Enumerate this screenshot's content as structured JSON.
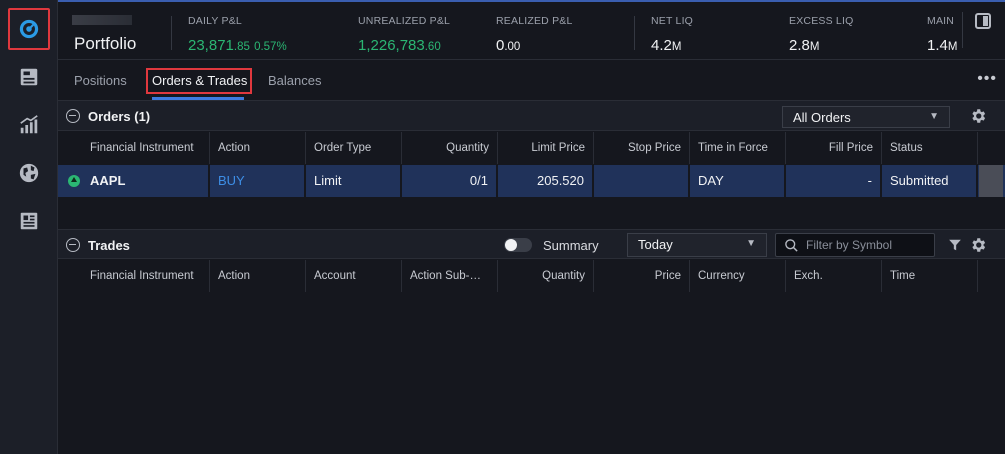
{
  "header": {
    "title": "Portfolio",
    "metrics": [
      {
        "label": "DAILY P&L",
        "value": "23,871",
        "decimals": ".85",
        "extra": "0.57%"
      },
      {
        "label": "UNREALIZED P&L",
        "value": "1,226,783",
        "decimals": ".60",
        "extra": ""
      },
      {
        "label": "REALIZED P&L",
        "value": "0",
        "decimals": ".00",
        "extra": ""
      },
      {
        "label": "NET LIQ",
        "value": "4.2",
        "decimals": "M",
        "extra": ""
      },
      {
        "label": "EXCESS LIQ",
        "value": "2.8",
        "decimals": "M",
        "extra": ""
      },
      {
        "label": "MAIN",
        "value": "1.4",
        "decimals": "M",
        "extra": ""
      }
    ]
  },
  "tabs": [
    "Positions",
    "Orders & Trades",
    "Balances"
  ],
  "more": "•••",
  "orders": {
    "title": "Orders (1)",
    "filter": "All Orders",
    "columns": [
      "Financial Instrument",
      "Action",
      "Order Type",
      "Quantity",
      "Limit Price",
      "Stop Price",
      "Time in Force",
      "Fill Price",
      "Status"
    ],
    "row": {
      "instrument": "AAPL",
      "action": "BUY",
      "order_type": "Limit",
      "quantity": "0/1",
      "limit_price": "205.520",
      "stop_price": "",
      "tif": "DAY",
      "fill_price": "-",
      "status": "Submitted"
    }
  },
  "trades": {
    "title": "Trades",
    "summary_label": "Summary",
    "period": "Today",
    "search_placeholder": "Filter by Symbol",
    "columns": [
      "Financial Instrument",
      "Action",
      "Account",
      "Action Sub-…",
      "Quantity",
      "Price",
      "Currency",
      "Exch.",
      "Time"
    ]
  },
  "colors": {
    "accent": "#3d7ae0",
    "positive": "#2bb673",
    "highlight": "#e0383e",
    "selected_row": "#20325a"
  }
}
